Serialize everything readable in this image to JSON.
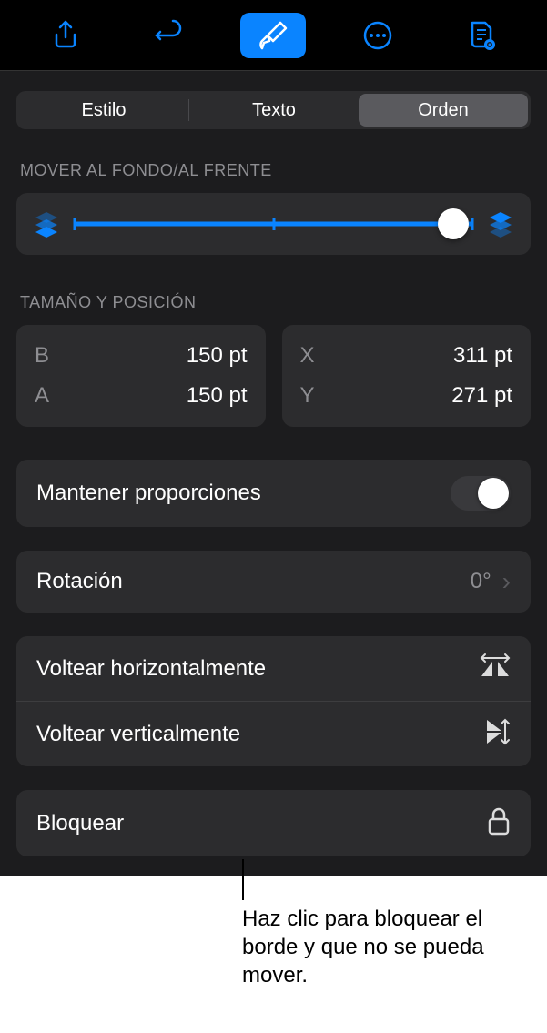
{
  "toolbar": {
    "share": "share-icon",
    "undo": "undo-icon",
    "format": "format-brush-icon",
    "more": "more-icon",
    "document": "document-icon"
  },
  "tabs": {
    "style": "Estilo",
    "text": "Texto",
    "arrange": "Orden"
  },
  "arrange": {
    "move_label": "MOVER AL FONDO/AL FRENTE",
    "size_pos_label": "TAMAÑO Y POSICIÓN",
    "width_key": "B",
    "width_val": "150 pt",
    "height_key": "A",
    "height_val": "150 pt",
    "x_key": "X",
    "x_val": "311 pt",
    "y_key": "Y",
    "y_val": "271 pt",
    "constrain": "Mantener proporciones",
    "rotation_label": "Rotación",
    "rotation_val": "0°",
    "flip_h": "Voltear horizontalmente",
    "flip_v": "Voltear verticalmente",
    "lock": "Bloquear"
  },
  "annotation": "Haz clic para bloquear el borde y que no se pueda mover."
}
